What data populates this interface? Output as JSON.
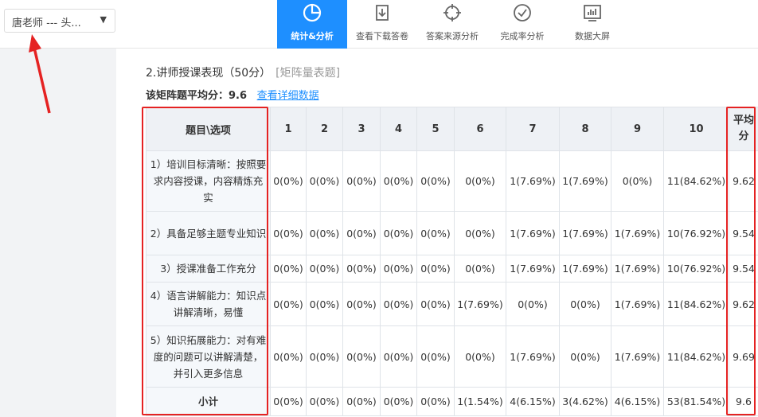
{
  "header": {
    "teacher_select": {
      "value": "唐老师 --- 头...",
      "caret": "▼"
    },
    "nav": [
      {
        "label": "统计&分析",
        "icon": "pie-chart-icon",
        "active": true
      },
      {
        "label": "查看下载答卷",
        "icon": "download-icon",
        "active": false
      },
      {
        "label": "答案来源分析",
        "icon": "crosshair-icon",
        "active": false
      },
      {
        "label": "完成率分析",
        "icon": "check-circle-icon",
        "active": false
      },
      {
        "label": "数据大屏",
        "icon": "dashboard-screen-icon",
        "active": false
      }
    ]
  },
  "question": {
    "title": "2.讲师授课表现（50分）",
    "tag": "[矩阵量表题]",
    "avg_label": "该矩阵题平均分：",
    "avg_value": "9.6",
    "detail_link": "查看详细数据"
  },
  "matrix": {
    "columns": [
      "题目\\选项",
      "1",
      "2",
      "3",
      "4",
      "5",
      "6",
      "7",
      "8",
      "9",
      "10",
      "平均分"
    ],
    "rows": [
      {
        "label": "1）培训目标清晰：按照要求内容授课，内容精炼充实",
        "cells": [
          "0(0%)",
          "0(0%)",
          "0(0%)",
          "0(0%)",
          "0(0%)",
          "0(0%)",
          "1(7.69%)",
          "1(7.69%)",
          "0(0%)",
          "11(84.62%)"
        ],
        "avg": "9.62"
      },
      {
        "label": "2）具备足够主题专业知识",
        "cells": [
          "0(0%)",
          "0(0%)",
          "0(0%)",
          "0(0%)",
          "0(0%)",
          "0(0%)",
          "1(7.69%)",
          "1(7.69%)",
          "1(7.69%)",
          "10(76.92%)"
        ],
        "avg": "9.54"
      },
      {
        "label": "3）授课准备工作充分",
        "cells": [
          "0(0%)",
          "0(0%)",
          "0(0%)",
          "0(0%)",
          "0(0%)",
          "0(0%)",
          "1(7.69%)",
          "1(7.69%)",
          "1(7.69%)",
          "10(76.92%)"
        ],
        "avg": "9.54"
      },
      {
        "label": "4）语言讲解能力：知识点讲解清晰，易懂",
        "cells": [
          "0(0%)",
          "0(0%)",
          "0(0%)",
          "0(0%)",
          "0(0%)",
          "1(7.69%)",
          "0(0%)",
          "0(0%)",
          "1(7.69%)",
          "11(84.62%)"
        ],
        "avg": "9.62"
      },
      {
        "label": "5）知识拓展能力：对有难度的问题可以讲解清楚，并引入更多信息",
        "cells": [
          "0(0%)",
          "0(0%)",
          "0(0%)",
          "0(0%)",
          "0(0%)",
          "0(0%)",
          "1(7.69%)",
          "0(0%)",
          "1(7.69%)",
          "11(84.62%)"
        ],
        "avg": "9.69"
      }
    ],
    "subtotal": {
      "label": "小计",
      "cells": [
        "0(0%)",
        "0(0%)",
        "0(0%)",
        "0(0%)",
        "0(0%)",
        "1(1.54%)",
        "4(6.15%)",
        "3(4.62%)",
        "4(6.15%)",
        "53(81.54%)"
      ],
      "avg": "9.6"
    }
  },
  "colors": {
    "accent": "#1e8fff",
    "annotation_red": "#e52222",
    "header_bg": "#eef1f5"
  }
}
